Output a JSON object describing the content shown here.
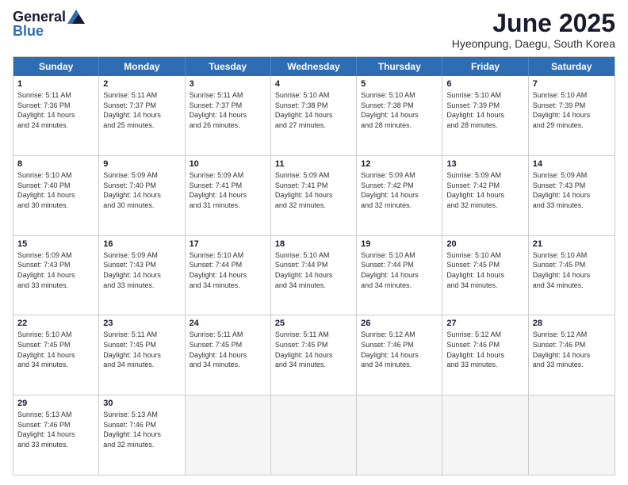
{
  "header": {
    "logo_general": "General",
    "logo_blue": "Blue",
    "month": "June 2025",
    "location": "Hyeonpung, Daegu, South Korea"
  },
  "weekdays": [
    "Sunday",
    "Monday",
    "Tuesday",
    "Wednesday",
    "Thursday",
    "Friday",
    "Saturday"
  ],
  "rows": [
    [
      {
        "day": "1",
        "lines": [
          "Sunrise: 5:11 AM",
          "Sunset: 7:36 PM",
          "Daylight: 14 hours",
          "and 24 minutes."
        ]
      },
      {
        "day": "2",
        "lines": [
          "Sunrise: 5:11 AM",
          "Sunset: 7:37 PM",
          "Daylight: 14 hours",
          "and 25 minutes."
        ]
      },
      {
        "day": "3",
        "lines": [
          "Sunrise: 5:11 AM",
          "Sunset: 7:37 PM",
          "Daylight: 14 hours",
          "and 26 minutes."
        ]
      },
      {
        "day": "4",
        "lines": [
          "Sunrise: 5:10 AM",
          "Sunset: 7:38 PM",
          "Daylight: 14 hours",
          "and 27 minutes."
        ]
      },
      {
        "day": "5",
        "lines": [
          "Sunrise: 5:10 AM",
          "Sunset: 7:38 PM",
          "Daylight: 14 hours",
          "and 28 minutes."
        ]
      },
      {
        "day": "6",
        "lines": [
          "Sunrise: 5:10 AM",
          "Sunset: 7:39 PM",
          "Daylight: 14 hours",
          "and 28 minutes."
        ]
      },
      {
        "day": "7",
        "lines": [
          "Sunrise: 5:10 AM",
          "Sunset: 7:39 PM",
          "Daylight: 14 hours",
          "and 29 minutes."
        ]
      }
    ],
    [
      {
        "day": "8",
        "lines": [
          "Sunrise: 5:10 AM",
          "Sunset: 7:40 PM",
          "Daylight: 14 hours",
          "and 30 minutes."
        ]
      },
      {
        "day": "9",
        "lines": [
          "Sunrise: 5:09 AM",
          "Sunset: 7:40 PM",
          "Daylight: 14 hours",
          "and 30 minutes."
        ]
      },
      {
        "day": "10",
        "lines": [
          "Sunrise: 5:09 AM",
          "Sunset: 7:41 PM",
          "Daylight: 14 hours",
          "and 31 minutes."
        ]
      },
      {
        "day": "11",
        "lines": [
          "Sunrise: 5:09 AM",
          "Sunset: 7:41 PM",
          "Daylight: 14 hours",
          "and 32 minutes."
        ]
      },
      {
        "day": "12",
        "lines": [
          "Sunrise: 5:09 AM",
          "Sunset: 7:42 PM",
          "Daylight: 14 hours",
          "and 32 minutes."
        ]
      },
      {
        "day": "13",
        "lines": [
          "Sunrise: 5:09 AM",
          "Sunset: 7:42 PM",
          "Daylight: 14 hours",
          "and 32 minutes."
        ]
      },
      {
        "day": "14",
        "lines": [
          "Sunrise: 5:09 AM",
          "Sunset: 7:43 PM",
          "Daylight: 14 hours",
          "and 33 minutes."
        ]
      }
    ],
    [
      {
        "day": "15",
        "lines": [
          "Sunrise: 5:09 AM",
          "Sunset: 7:43 PM",
          "Daylight: 14 hours",
          "and 33 minutes."
        ]
      },
      {
        "day": "16",
        "lines": [
          "Sunrise: 5:09 AM",
          "Sunset: 7:43 PM",
          "Daylight: 14 hours",
          "and 33 minutes."
        ]
      },
      {
        "day": "17",
        "lines": [
          "Sunrise: 5:10 AM",
          "Sunset: 7:44 PM",
          "Daylight: 14 hours",
          "and 34 minutes."
        ]
      },
      {
        "day": "18",
        "lines": [
          "Sunrise: 5:10 AM",
          "Sunset: 7:44 PM",
          "Daylight: 14 hours",
          "and 34 minutes."
        ]
      },
      {
        "day": "19",
        "lines": [
          "Sunrise: 5:10 AM",
          "Sunset: 7:44 PM",
          "Daylight: 14 hours",
          "and 34 minutes."
        ]
      },
      {
        "day": "20",
        "lines": [
          "Sunrise: 5:10 AM",
          "Sunset: 7:45 PM",
          "Daylight: 14 hours",
          "and 34 minutes."
        ]
      },
      {
        "day": "21",
        "lines": [
          "Sunrise: 5:10 AM",
          "Sunset: 7:45 PM",
          "Daylight: 14 hours",
          "and 34 minutes."
        ]
      }
    ],
    [
      {
        "day": "22",
        "lines": [
          "Sunrise: 5:10 AM",
          "Sunset: 7:45 PM",
          "Daylight: 14 hours",
          "and 34 minutes."
        ]
      },
      {
        "day": "23",
        "lines": [
          "Sunrise: 5:11 AM",
          "Sunset: 7:45 PM",
          "Daylight: 14 hours",
          "and 34 minutes."
        ]
      },
      {
        "day": "24",
        "lines": [
          "Sunrise: 5:11 AM",
          "Sunset: 7:45 PM",
          "Daylight: 14 hours",
          "and 34 minutes."
        ]
      },
      {
        "day": "25",
        "lines": [
          "Sunrise: 5:11 AM",
          "Sunset: 7:45 PM",
          "Daylight: 14 hours",
          "and 34 minutes."
        ]
      },
      {
        "day": "26",
        "lines": [
          "Sunrise: 5:12 AM",
          "Sunset: 7:46 PM",
          "Daylight: 14 hours",
          "and 34 minutes."
        ]
      },
      {
        "day": "27",
        "lines": [
          "Sunrise: 5:12 AM",
          "Sunset: 7:46 PM",
          "Daylight: 14 hours",
          "and 33 minutes."
        ]
      },
      {
        "day": "28",
        "lines": [
          "Sunrise: 5:12 AM",
          "Sunset: 7:46 PM",
          "Daylight: 14 hours",
          "and 33 minutes."
        ]
      }
    ],
    [
      {
        "day": "29",
        "lines": [
          "Sunrise: 5:13 AM",
          "Sunset: 7:46 PM",
          "Daylight: 14 hours",
          "and 33 minutes."
        ]
      },
      {
        "day": "30",
        "lines": [
          "Sunrise: 5:13 AM",
          "Sunset: 7:46 PM",
          "Daylight: 14 hours",
          "and 32 minutes."
        ]
      },
      {
        "day": "",
        "lines": []
      },
      {
        "day": "",
        "lines": []
      },
      {
        "day": "",
        "lines": []
      },
      {
        "day": "",
        "lines": []
      },
      {
        "day": "",
        "lines": []
      }
    ]
  ]
}
